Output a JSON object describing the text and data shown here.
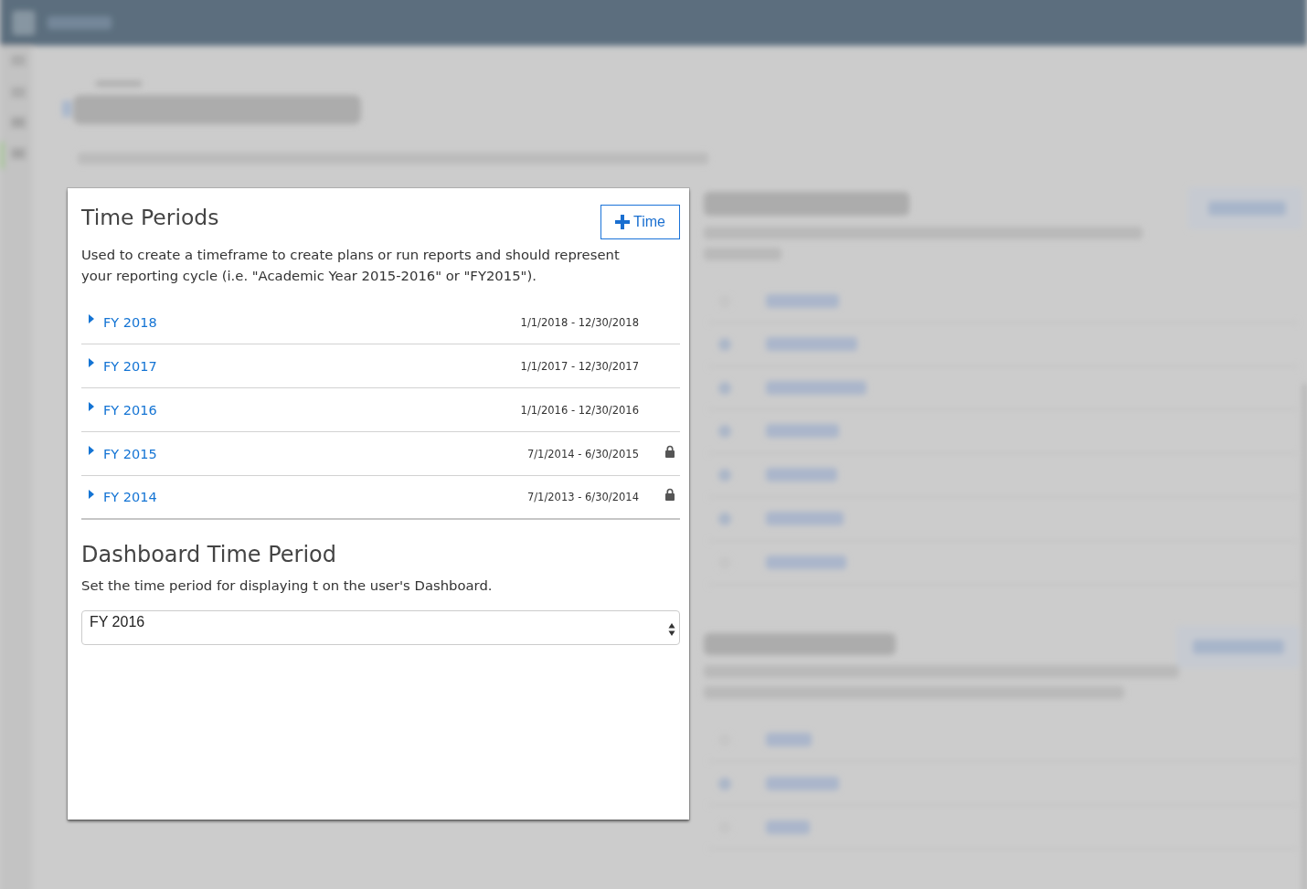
{
  "time_periods": {
    "title": "Time Periods",
    "add_button": {
      "label": "Time"
    },
    "description": "Used to create a timeframe to create plans or run reports and should represent your reporting cycle (i.e. \"Academic Year 2015-2016\" or \"FY2015\").",
    "periods": [
      {
        "name": "FY 2018",
        "dates": "1/1/2018 - 12/30/2018",
        "expanded": false,
        "locked": false
      },
      {
        "name": "FY 2017",
        "dates": "1/1/2017 - 12/30/2017",
        "expanded": false,
        "locked": false
      },
      {
        "name": "FY 2016",
        "dates": "1/1/2016 - 12/30/2016",
        "expanded": false,
        "locked": false
      },
      {
        "name": "FY 2015",
        "dates": "7/1/2014 - 6/30/2015",
        "expanded": false,
        "locked": true
      },
      {
        "name": "FY 2014",
        "dates": "7/1/2013 - 6/30/2014",
        "expanded": false,
        "locked": true
      }
    ]
  },
  "dashboard_time_period": {
    "title": "Dashboard Time Period",
    "description": "Set the time period for displaying t on the user's Dashboard.",
    "select": {
      "value": "FY 2016"
    }
  }
}
